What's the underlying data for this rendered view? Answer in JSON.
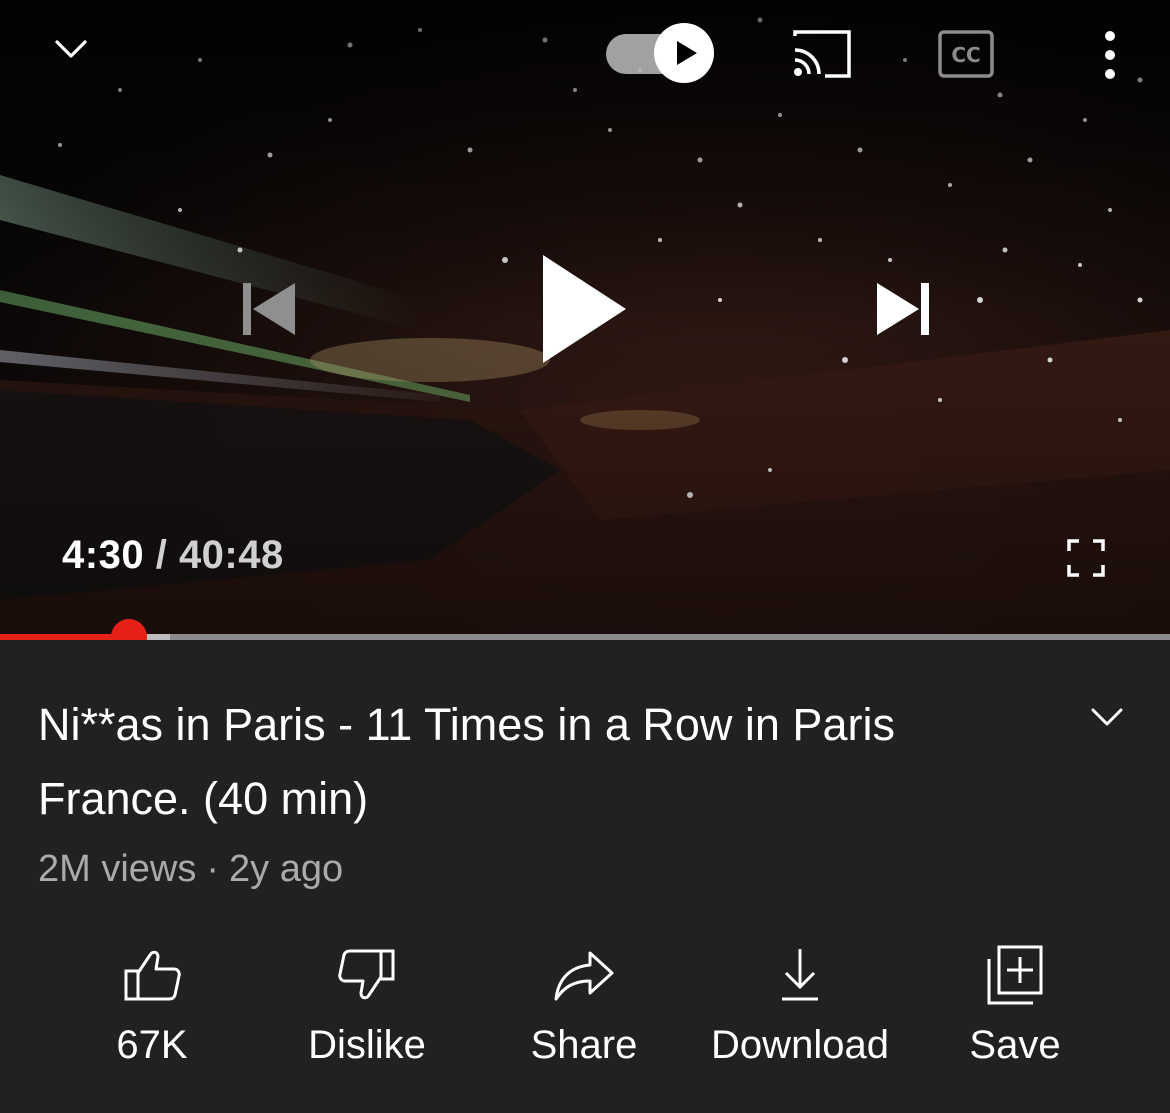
{
  "player": {
    "current_time": "4:30",
    "separator": "/",
    "duration": "40:48",
    "progress_fraction": 0.11,
    "buffered_fraction": 0.145,
    "autoplay_enabled": true,
    "accent_color": "#e62117",
    "icons": {
      "minimize": "chevron-down-icon",
      "autoplay": "autoplay-toggle-icon",
      "cast": "cast-icon",
      "captions": "closed-captions-icon",
      "more": "more-vertical-icon",
      "previous": "skip-previous-icon",
      "play": "play-icon",
      "next": "skip-next-icon",
      "fullscreen": "fullscreen-icon"
    }
  },
  "video": {
    "title": "Ni**as in Paris - 11 Times in a Row in Paris France. (40 min)",
    "views": "2M views",
    "dot": "·",
    "age": "2y ago"
  },
  "actions": {
    "like": {
      "label": "67K",
      "icon": "thumbs-up-icon"
    },
    "dislike": {
      "label": "Dislike",
      "icon": "thumbs-down-icon"
    },
    "share": {
      "label": "Share",
      "icon": "share-arrow-icon"
    },
    "download": {
      "label": "Download",
      "icon": "download-icon"
    },
    "save": {
      "label": "Save",
      "icon": "add-to-playlist-icon"
    }
  }
}
